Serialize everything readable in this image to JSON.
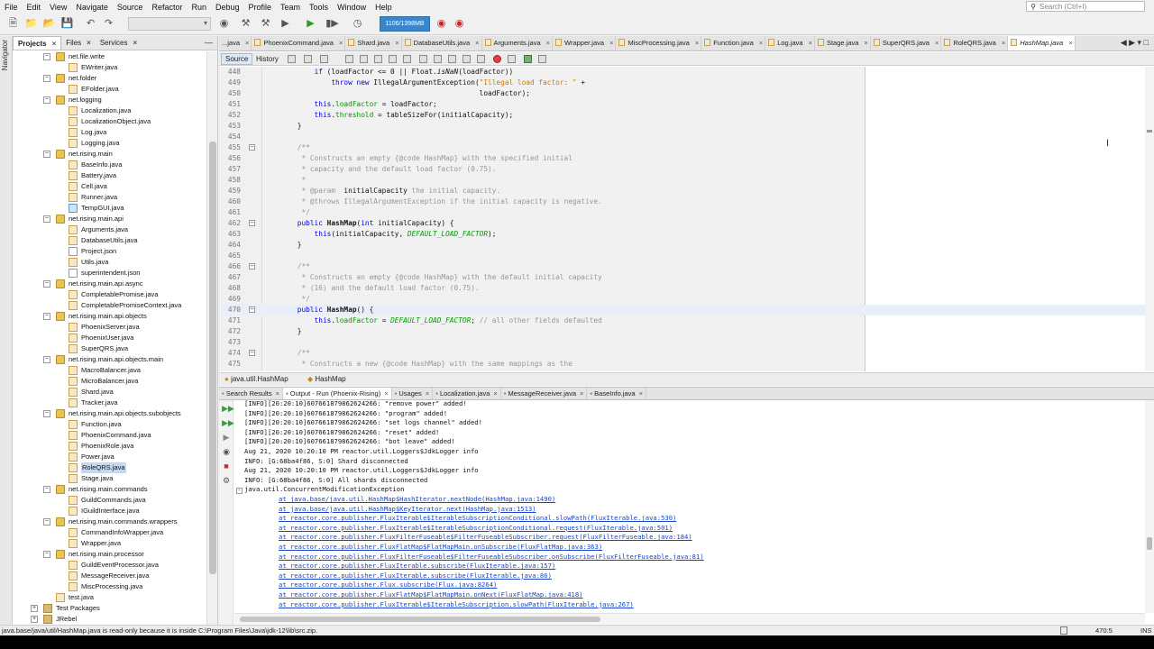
{
  "menu": [
    "File",
    "Edit",
    "View",
    "Navigate",
    "Source",
    "Refactor",
    "Run",
    "Debug",
    "Profile",
    "Team",
    "Tools",
    "Window",
    "Help"
  ],
  "search": {
    "placeholder": "Search (Ctrl+I)"
  },
  "toolbar": {
    "memory": "1106/1398MB"
  },
  "left_strip": {
    "navigator": "Navigator"
  },
  "project_panel": {
    "tabs": [
      {
        "label": "Projects",
        "active": true
      },
      {
        "label": "Files",
        "active": false
      },
      {
        "label": "Services",
        "active": false
      }
    ],
    "tree": [
      {
        "label": "net.file.write",
        "type": "pkg",
        "level": 1,
        "open": true
      },
      {
        "label": "EWriter.java",
        "type": "java",
        "level": 2
      },
      {
        "label": "net.folder",
        "type": "pkg",
        "level": 1,
        "open": true
      },
      {
        "label": "EFolder.java",
        "type": "java",
        "level": 2
      },
      {
        "label": "net.logging",
        "type": "pkg",
        "level": 1,
        "open": true
      },
      {
        "label": "Localization.java",
        "type": "java",
        "level": 2
      },
      {
        "label": "LocalizationObject.java",
        "type": "java",
        "level": 2
      },
      {
        "label": "Log.java",
        "type": "java",
        "level": 2
      },
      {
        "label": "Logging.java",
        "type": "java",
        "level": 2
      },
      {
        "label": "net.rising.main",
        "type": "pkg",
        "level": 1,
        "open": true
      },
      {
        "label": "BaseInfo.java",
        "type": "java",
        "level": 2
      },
      {
        "label": "Battery.java",
        "type": "java",
        "level": 2
      },
      {
        "label": "Cell.java",
        "type": "java",
        "level": 2
      },
      {
        "label": "Runner.java",
        "type": "java",
        "level": 2
      },
      {
        "label": "TempGUI.java",
        "type": "gui",
        "level": 2
      },
      {
        "label": "net.rising.main.api",
        "type": "pkg",
        "level": 1,
        "open": true
      },
      {
        "label": "Arguments.java",
        "type": "java",
        "level": 2
      },
      {
        "label": "DatabaseUtils.java",
        "type": "java",
        "level": 2
      },
      {
        "label": "Project.json",
        "type": "json",
        "level": 2
      },
      {
        "label": "Utils.java",
        "type": "java",
        "level": 2
      },
      {
        "label": "superintendent.json",
        "type": "json",
        "level": 2
      },
      {
        "label": "net.rising.main.api.async",
        "type": "pkg",
        "level": 1,
        "open": true
      },
      {
        "label": "CompletablePromise.java",
        "type": "java",
        "level": 2
      },
      {
        "label": "CompletablePromiseContext.java",
        "type": "java",
        "level": 2
      },
      {
        "label": "net.rising.main.api.objects",
        "type": "pkg",
        "level": 1,
        "open": true
      },
      {
        "label": "PhoenixServer.java",
        "type": "java",
        "level": 2
      },
      {
        "label": "PhoenixUser.java",
        "type": "java",
        "level": 2
      },
      {
        "label": "SuperQRS.java",
        "type": "java",
        "level": 2
      },
      {
        "label": "net.rising.main.api.objects.main",
        "type": "pkg",
        "level": 1,
        "open": true
      },
      {
        "label": "MacroBalancer.java",
        "type": "java",
        "level": 2
      },
      {
        "label": "MicroBalancer.java",
        "type": "java",
        "level": 2
      },
      {
        "label": "Shard.java",
        "type": "java",
        "level": 2
      },
      {
        "label": "Tracker.java",
        "type": "java",
        "level": 2
      },
      {
        "label": "net.rising.main.api.objects.subobjects",
        "type": "pkg",
        "level": 1,
        "open": true
      },
      {
        "label": "Function.java",
        "type": "java",
        "level": 2
      },
      {
        "label": "PhoenixCommand.java",
        "type": "java",
        "level": 2
      },
      {
        "label": "PhoenixRole.java",
        "type": "java",
        "level": 2
      },
      {
        "label": "Power.java",
        "type": "java",
        "level": 2
      },
      {
        "label": "RoleQRS.java",
        "type": "java",
        "level": 2,
        "selected": true
      },
      {
        "label": "Stage.java",
        "type": "java",
        "level": 2
      },
      {
        "label": "net.rising.main.commands",
        "type": "pkg",
        "level": 1,
        "open": true
      },
      {
        "label": "GuildCommands.java",
        "type": "java",
        "level": 2
      },
      {
        "label": "IGuildInterface.java",
        "type": "java",
        "level": 2
      },
      {
        "label": "net.rising.main.commands.wrappers",
        "type": "pkg",
        "level": 1,
        "open": true
      },
      {
        "label": "CommandInfoWrapper.java",
        "type": "java",
        "level": 2
      },
      {
        "label": "Wrapper.java",
        "type": "java",
        "level": 2
      },
      {
        "label": "net.rising.main.processor",
        "type": "pkg",
        "level": 1,
        "open": true
      },
      {
        "label": "GuildEventProcessor.java",
        "type": "java",
        "level": 2
      },
      {
        "label": "MessageReceiver.java",
        "type": "java",
        "level": 2
      },
      {
        "label": "MiscProcessing.java",
        "type": "java",
        "level": 2
      },
      {
        "label": "test.java",
        "type": "java",
        "level": 1
      },
      {
        "label": "Test Packages",
        "type": "folder",
        "level": 0,
        "open": false
      },
      {
        "label": "JRebel",
        "type": "folder",
        "level": 0,
        "open": false
      }
    ]
  },
  "editor": {
    "tabs": [
      {
        "label": "...java",
        "icon": false
      },
      {
        "label": "PhoenixCommand.java",
        "icon": true
      },
      {
        "label": "Shard.java",
        "icon": true
      },
      {
        "label": "DatabaseUtils.java",
        "icon": true
      },
      {
        "label": "Arguments.java",
        "icon": true
      },
      {
        "label": "Wrapper.java",
        "icon": true
      },
      {
        "label": "MiscProcessing.java",
        "icon": true
      },
      {
        "label": "Function.java",
        "icon": true
      },
      {
        "label": "Log.java",
        "icon": true
      },
      {
        "label": "Stage.java",
        "icon": true
      },
      {
        "label": "SuperQRS.java",
        "icon": true
      },
      {
        "label": "RoleQRS.java",
        "icon": true
      },
      {
        "label": "HashMap.java",
        "icon": true,
        "active": true
      }
    ],
    "source_label": "Source",
    "history_label": "History",
    "breadcrumbs": [
      "java.util.HashMap",
      "HashMap"
    ],
    "lines": [
      {
        "n": "448",
        "fold": "",
        "segs": [
          [
            "        ",
            ""
          ],
          [
            "if",
            "kw"
          ],
          [
            " (loadFactor <= 0 || Float.",
            ""
          ],
          [
            "isNaN",
            "it"
          ],
          [
            "(loadFactor))",
            ""
          ]
        ]
      },
      {
        "n": "449",
        "fold": "",
        "segs": [
          [
            "            ",
            ""
          ],
          [
            "throw new",
            "kw"
          ],
          [
            " IllegalArgumentException(",
            ""
          ],
          [
            "\"Illegal load factor: \"",
            "str"
          ],
          [
            " +",
            ""
          ]
        ]
      },
      {
        "n": "450",
        "fold": "",
        "segs": [
          [
            "                                               loadFactor);",
            ""
          ]
        ]
      },
      {
        "n": "451",
        "fold": "",
        "segs": [
          [
            "        ",
            ""
          ],
          [
            "this",
            "kw"
          ],
          [
            ".",
            ""
          ],
          [
            "loadFactor",
            "fld"
          ],
          [
            " = loadFactor;",
            ""
          ]
        ]
      },
      {
        "n": "452",
        "fold": "",
        "segs": [
          [
            "        ",
            ""
          ],
          [
            "this",
            "kw"
          ],
          [
            ".",
            ""
          ],
          [
            "threshold",
            "fld"
          ],
          [
            " = tableSizeFor(initialCapacity);",
            ""
          ]
        ]
      },
      {
        "n": "453",
        "fold": "",
        "segs": [
          [
            "    }",
            ""
          ]
        ]
      },
      {
        "n": "454",
        "fold": "",
        "segs": [
          [
            "",
            ""
          ]
        ]
      },
      {
        "n": "455",
        "fold": "-",
        "segs": [
          [
            "    /**",
            "cm"
          ]
        ]
      },
      {
        "n": "456",
        "fold": "",
        "segs": [
          [
            "     * Constructs an empty {@code HashMap} with the specified initial",
            "cm"
          ]
        ]
      },
      {
        "n": "457",
        "fold": "",
        "segs": [
          [
            "     * capacity and the default load factor (0.75).",
            "cm"
          ]
        ]
      },
      {
        "n": "458",
        "fold": "",
        "segs": [
          [
            "     *",
            "cm"
          ]
        ]
      },
      {
        "n": "459",
        "fold": "",
        "segs": [
          [
            "     * @param  ",
            "cm"
          ],
          [
            "initialCapacity",
            ""
          ],
          [
            " the initial capacity.",
            "cm"
          ]
        ]
      },
      {
        "n": "460",
        "fold": "",
        "segs": [
          [
            "     * @throws IllegalArgumentException if the initial capacity is negative.",
            "cm"
          ]
        ]
      },
      {
        "n": "461",
        "fold": "",
        "segs": [
          [
            "     */",
            "cm"
          ]
        ]
      },
      {
        "n": "462",
        "fold": "-",
        "segs": [
          [
            "    ",
            ""
          ],
          [
            "public",
            "kw"
          ],
          [
            " ",
            ""
          ],
          [
            "HashMap",
            "mth"
          ],
          [
            "(",
            ""
          ],
          [
            "int",
            "kw"
          ],
          [
            " initialCapacity) {",
            ""
          ]
        ]
      },
      {
        "n": "463",
        "fold": "",
        "segs": [
          [
            "        ",
            ""
          ],
          [
            "this",
            "kw"
          ],
          [
            "(initialCapacity, ",
            ""
          ],
          [
            "DEFAULT_LOAD_FACTOR",
            "cst"
          ],
          [
            ");",
            ""
          ]
        ]
      },
      {
        "n": "464",
        "fold": "",
        "segs": [
          [
            "    }",
            ""
          ]
        ]
      },
      {
        "n": "465",
        "fold": "",
        "segs": [
          [
            "",
            ""
          ]
        ]
      },
      {
        "n": "466",
        "fold": "-",
        "segs": [
          [
            "    /**",
            "cm"
          ]
        ]
      },
      {
        "n": "467",
        "fold": "",
        "segs": [
          [
            "     * Constructs an empty {@code HashMap} with the default initial capacity",
            "cm"
          ]
        ]
      },
      {
        "n": "468",
        "fold": "",
        "segs": [
          [
            "     * (16) and the default load factor (0.75).",
            "cm"
          ]
        ]
      },
      {
        "n": "469",
        "fold": "",
        "segs": [
          [
            "     */",
            "cm"
          ]
        ]
      },
      {
        "n": "470",
        "fold": "-",
        "hl": true,
        "segs": [
          [
            "    ",
            ""
          ],
          [
            "public",
            "kw"
          ],
          [
            " ",
            ""
          ],
          [
            "HashMap",
            "mth"
          ],
          [
            "() {",
            ""
          ]
        ]
      },
      {
        "n": "471",
        "fold": "",
        "segs": [
          [
            "        ",
            ""
          ],
          [
            "this",
            "kw"
          ],
          [
            ".",
            ""
          ],
          [
            "loadFactor",
            "fld"
          ],
          [
            " = ",
            ""
          ],
          [
            "DEFAULT_LOAD_FACTOR",
            "cst"
          ],
          [
            "; ",
            ""
          ],
          [
            "// all other fields defaulted",
            "cm"
          ]
        ]
      },
      {
        "n": "472",
        "fold": "",
        "segs": [
          [
            "    }",
            ""
          ]
        ]
      },
      {
        "n": "473",
        "fold": "",
        "segs": [
          [
            "",
            ""
          ]
        ]
      },
      {
        "n": "474",
        "fold": "-",
        "segs": [
          [
            "    /**",
            "cm"
          ]
        ]
      },
      {
        "n": "475",
        "fold": "",
        "segs": [
          [
            "     * Constructs a new {@code HashMap} with the same mappings as the",
            "cm"
          ]
        ]
      }
    ]
  },
  "output": {
    "tabs": [
      {
        "label": "Search Results",
        "active": false
      },
      {
        "label": "Output - Run (Phoenix-Rising)",
        "active": true
      },
      {
        "label": "Usages",
        "active": false
      },
      {
        "label": "Localization.java",
        "active": false
      },
      {
        "label": "MessageReceiver.java",
        "active": false
      },
      {
        "label": "BaseInfo.java",
        "active": false
      }
    ],
    "lines": [
      "[INFO][20:20:10]607661879862624266: \"remove power\" added!",
      "[INFO][20:20:10]607661879862624266: \"program\" added!",
      "[INFO][20:20:10]607661879862624266: \"set logs channel\" added!",
      "[INFO][20:20:10]607661879862624266: \"reset\" added!",
      "[INFO][20:20:10]607661879862624266: \"bot leave\" added!",
      "Aug 21, 2020 10:20:10 PM reactor.util.Loggers$JdkLogger info",
      "INFO: [G:68ba4f86, S:0] Shard disconnected",
      "Aug 21, 2020 10:20:10 PM reactor.util.Loggers$JdkLogger info",
      "INFO: [G:68ba4f86, S:0] All shards disconnected",
      "java.util.ConcurrentModificationException"
    ],
    "stack": [
      "at java.base/java.util.HashMap$HashIterator.nextNode(HashMap.java:1490)",
      "at java.base/java.util.HashMap$KeyIterator.next(HashMap.java:1513)",
      "at reactor.core.publisher.FluxIterable$IterableSubscriptionConditional.slowPath(FluxIterable.java:530)",
      "at reactor.core.publisher.FluxIterable$IterableSubscriptionConditional.request(FluxIterable.java:501)",
      "at reactor.core.publisher.FluxFilterFuseable$FilterFuseableSubscriber.request(FluxFilterFuseable.java:184)",
      "at reactor.core.publisher.FluxFlatMap$FlatMapMain.onSubscribe(FluxFlatMap.java:363)",
      "at reactor.core.publisher.FluxFilterFuseable$FilterFuseableSubscriber.onSubscribe(FluxFilterFuseable.java:81)",
      "at reactor.core.publisher.FluxIterable.subscribe(FluxIterable.java:157)",
      "at reactor.core.publisher.FluxIterable.subscribe(FluxIterable.java:86)",
      "at reactor.core.publisher.Flux.subscribe(Flux.java:8264)",
      "at reactor.core.publisher.FluxFlatMap$FlatMapMain.onNext(FluxFlatMap.java:418)",
      "at reactor.core.publisher.FluxIterable$IterableSubscription.slowPath(FluxIterable.java:267)"
    ]
  },
  "status": {
    "message": "java.base/java/util/HashMap.java is read-only because it is inside C:\\Program Files\\Java\\jdk-12\\lib\\src.zip.",
    "position": "470:5",
    "mode": "INS"
  }
}
